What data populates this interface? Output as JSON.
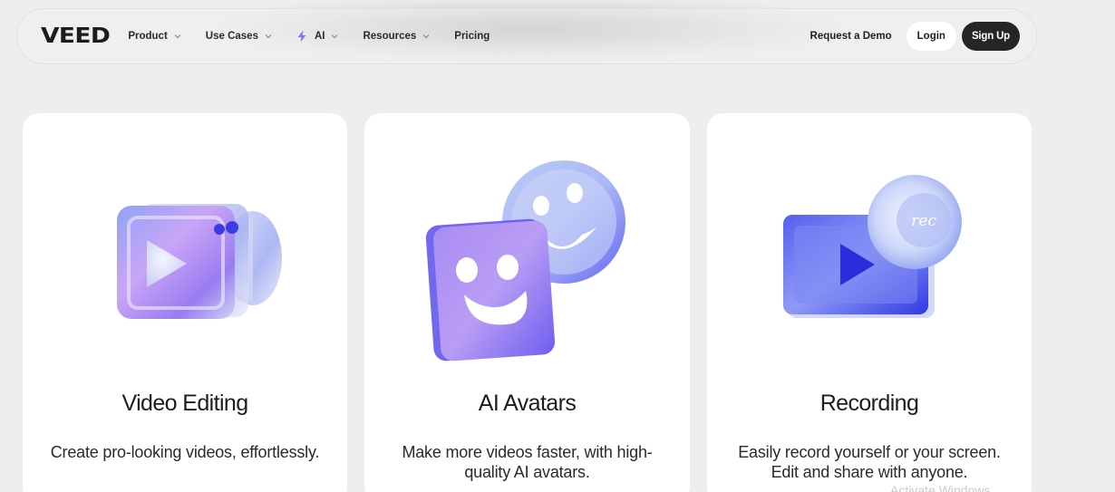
{
  "brand": {
    "logo": "VEED"
  },
  "nav": {
    "items": [
      {
        "label": "Product",
        "has_dropdown": true
      },
      {
        "label": "Use Cases",
        "has_dropdown": true
      },
      {
        "label": "AI",
        "has_dropdown": true,
        "icon": "lightning-icon"
      },
      {
        "label": "Resources",
        "has_dropdown": true
      },
      {
        "label": "Pricing",
        "has_dropdown": false
      }
    ],
    "request_demo": "Request a Demo",
    "login": "Login",
    "signup": "Sign Up"
  },
  "cards": [
    {
      "title": "Video Editing",
      "description": "Create pro-looking videos, effortlessly.",
      "illustration": "video-camera-icon"
    },
    {
      "title": "AI Avatars",
      "description": "Make more videos faster, with high-quality AI avatars.",
      "illustration": "smiley-faces-icon"
    },
    {
      "title": "Recording",
      "description": "Easily record yourself or your screen. Edit and share with anyone.",
      "illustration": "record-screen-icon",
      "badge_text": "rec"
    }
  ],
  "watermark": "Activate Windows",
  "colors": {
    "background": "#edeeed",
    "card": "#ffffff",
    "signup_bg": "#252525",
    "accent_purple": "#7b5cf0",
    "accent_blue": "#4a4ef0"
  }
}
